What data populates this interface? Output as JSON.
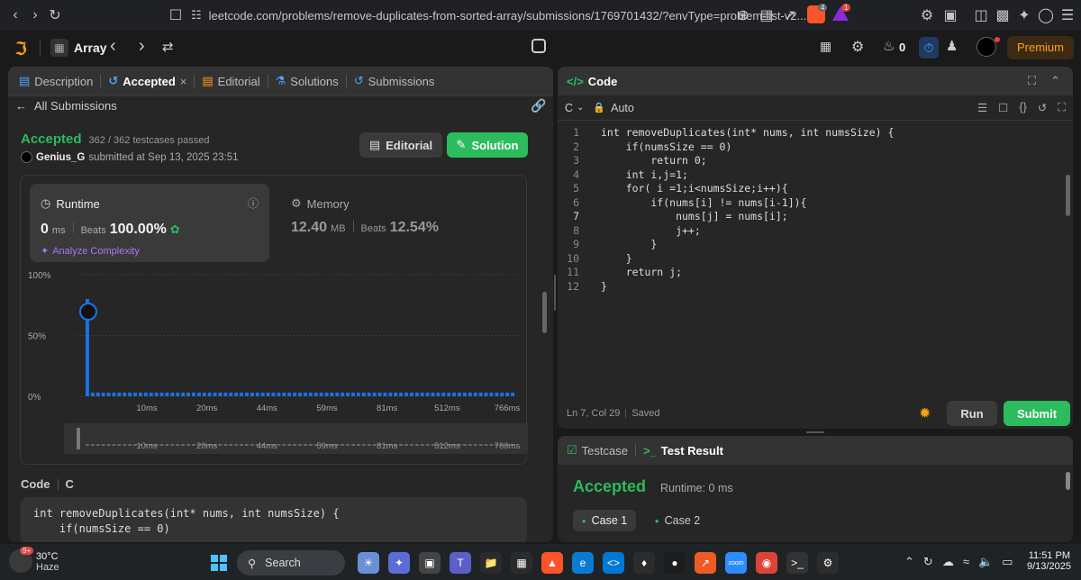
{
  "browser": {
    "url": "leetcode.com/problems/remove-duplicates-from-sorted-array/submissions/1769701432/?envType=problem-list-v2...",
    "shield_badge": "4",
    "alert_badge": "1"
  },
  "header": {
    "list_name": "Array",
    "streak_count": "0",
    "premium_label": "Premium"
  },
  "left_tabs": {
    "description": "Description",
    "accepted": "Accepted",
    "editorial": "Editorial",
    "solutions": "Solutions",
    "submissions": "Submissions"
  },
  "submission": {
    "back_label": "All Submissions",
    "status": "Accepted",
    "testcases": "362 / 362 testcases passed",
    "user": "Genius_G",
    "submitted_at": "submitted at Sep 13, 2025 23:51",
    "editorial_button": "Editorial",
    "solution_button": "Solution"
  },
  "runtime_card": {
    "title": "Runtime",
    "value": "0",
    "unit": "ms",
    "beats_label": "Beats",
    "beats_value": "100.00%",
    "analyze": "Analyze Complexity"
  },
  "memory_card": {
    "title": "Memory",
    "value": "12.40",
    "unit": "MB",
    "beats_label": "Beats",
    "beats_value": "12.54%"
  },
  "chart_data": {
    "type": "bar",
    "yticks": [
      "100%",
      "50%",
      "0%"
    ],
    "xticks": [
      "10ms",
      "20ms",
      "44ms",
      "59ms",
      "81ms",
      "512ms",
      "766ms"
    ],
    "ylim": [
      0,
      100
    ],
    "values": [
      80,
      3,
      3,
      3,
      3,
      3,
      3,
      3,
      3,
      3,
      3,
      3,
      3,
      3,
      3,
      3,
      3,
      3,
      3,
      3,
      3,
      3,
      3,
      3,
      3,
      3,
      3,
      3,
      3,
      3,
      3,
      3,
      3,
      3,
      3,
      3,
      3,
      3,
      3,
      3,
      3,
      3,
      3,
      3,
      3,
      3,
      3,
      3,
      3,
      3,
      3,
      3,
      3,
      3,
      3,
      3,
      3,
      3,
      3,
      3,
      3,
      3,
      3,
      3,
      3,
      3,
      3,
      3,
      3,
      3,
      3,
      3,
      3,
      3,
      3,
      3,
      3,
      3,
      3,
      3,
      3
    ],
    "bar_color": "#1a73e8",
    "grid": true
  },
  "code_section": {
    "label": "Code",
    "lang": "C",
    "preview": [
      "int removeDuplicates(int* nums, int numsSize) {",
      "    if(numsSize == 0)"
    ]
  },
  "editor": {
    "title": "Code",
    "lang": "C",
    "mode": "Auto",
    "lines": [
      "int removeDuplicates(int* nums, int numsSize) {",
      "    if(numsSize == 0)",
      "        return 0;",
      "    int i,j=1;",
      "    for( i =1;i<numsSize;i++){",
      "        if(nums[i] != nums[i-1]){",
      "            nums[j] = nums[i];",
      "            j++;",
      "        }",
      "    }",
      "    return j;",
      "}"
    ],
    "status": "Ln 7, Col 29",
    "saved": "Saved",
    "run": "Run",
    "submit": "Submit"
  },
  "result": {
    "tab_testcase": "Testcase",
    "tab_result": "Test Result",
    "status": "Accepted",
    "runtime": "Runtime: 0 ms",
    "case1": "Case 1",
    "case2": "Case 2"
  },
  "taskbar": {
    "temp": "30°C",
    "weather": "Haze",
    "search": "Search",
    "time": "11:51 PM",
    "date": "9/13/2025",
    "weather_badge": "9+"
  }
}
